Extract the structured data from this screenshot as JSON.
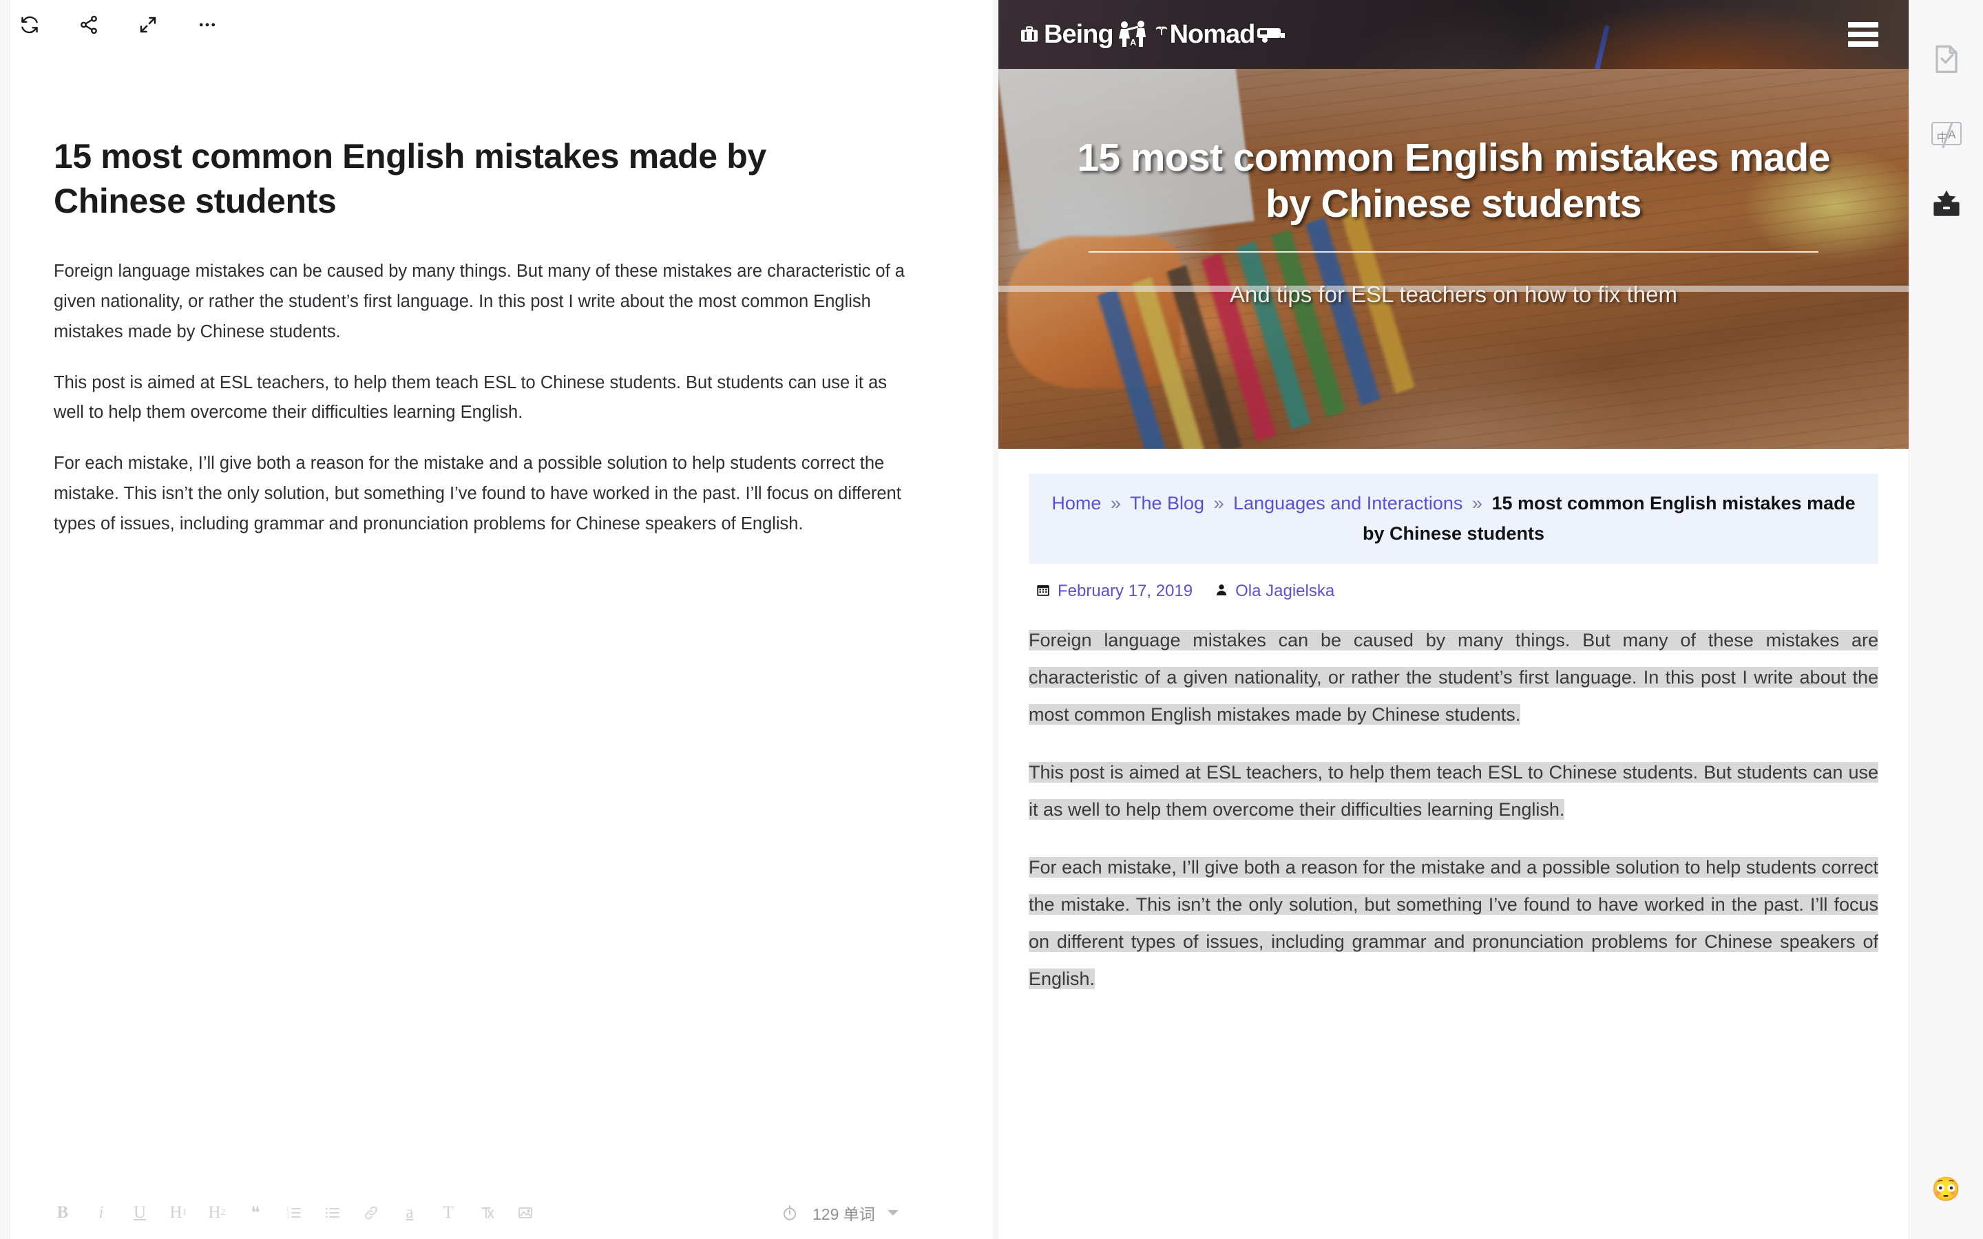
{
  "editor": {
    "toolbar": [
      {
        "name": "sync-icon",
        "label": "Sync"
      },
      {
        "name": "share-icon",
        "label": "Share"
      },
      {
        "name": "fullscreen-icon",
        "label": "Fullscreen"
      },
      {
        "name": "more-icon",
        "label": "More"
      }
    ],
    "title": "15 most common English mistakes made by Chinese students",
    "paragraphs": [
      "Foreign language mistakes can be caused by many things. But many of these mistakes are characteristic of a given nationality, or rather the student’s first language. In this post I write about the most common English mistakes made by Chinese students.",
      "This post is aimed at ESL teachers, to help them teach ESL to Chinese students. But students can use it as well to help them overcome their difficulties learning English.",
      "For each mistake, I’ll give both a reason for the mistake and a possible solution to help students correct the mistake. This isn’t the only solution, but something I’ve found to have worked in the past. I’ll focus on different types of issues, including grammar and pronunciation problems for Chinese speakers of English."
    ],
    "format_bar": {
      "bold": "B",
      "italic": "i",
      "underline": "U",
      "heading1": "H",
      "heading1_sub": "1",
      "heading2": "H",
      "heading2_sub": "2",
      "quote": "❝",
      "ordered_list": "ordered-list-icon",
      "unordered_list": "unordered-list-icon",
      "link": "link-icon",
      "highlight": "a",
      "text_color": "T",
      "clear_format": "clear-format-icon",
      "image": "image-icon"
    },
    "status": {
      "timer_icon": "stopwatch-icon",
      "word_count": "129 单词"
    }
  },
  "preview": {
    "site": {
      "logo_text_1": "Being",
      "logo_text_a": "A",
      "logo_text_2": "Nomad",
      "menu_icon": "hamburger-menu-icon"
    },
    "hero": {
      "title": "15 most common English mistakes made by Chinese students",
      "subtitle": "And tips for ESL teachers on how to fix them"
    },
    "breadcrumb": {
      "items": [
        {
          "label": "Home",
          "current": false
        },
        {
          "label": "The Blog",
          "current": false
        },
        {
          "label": "Languages and Interactions",
          "current": false
        },
        {
          "label": "15 most common English mistakes made by Chinese students",
          "current": true
        }
      ],
      "separator": "»"
    },
    "meta": {
      "date_icon": "calendar-icon",
      "date": "February 17, 2019",
      "author_icon": "user-icon",
      "author": "Ola Jagielska"
    },
    "paragraphs": [
      "Foreign language mistakes can be caused by many things. But many of these mistakes are characteristic of a given nationality, or rather the student’s first language. In this post I write about the most common English mistakes made by Chinese students.",
      "This post is aimed at ESL teachers, to help them teach ESL to Chinese students. But students can use it as well to help them overcome their difficulties learning English.",
      "For each mistake, I’ll give both a reason for the mistake and a possible solution to help students correct the mistake. This isn’t the only solution, but something I’ve found to have worked in the past. I’ll focus on different types of issues, including grammar and pronunciation problems for Chinese speakers of English."
    ]
  },
  "rail": {
    "check_icon": "document-check-icon",
    "translate_icon": "translate-icon",
    "translate_zh": "中",
    "translate_en": "A",
    "archive_icon": "archive-box-icon",
    "emoji": "😳"
  },
  "colors": {
    "link": "#5b4fd6",
    "breadcrumb_bg": "#eef2fb",
    "selection": "#d8d8d8",
    "header_bg": "#2b2529",
    "rail_bg": "#f7f7f8"
  }
}
